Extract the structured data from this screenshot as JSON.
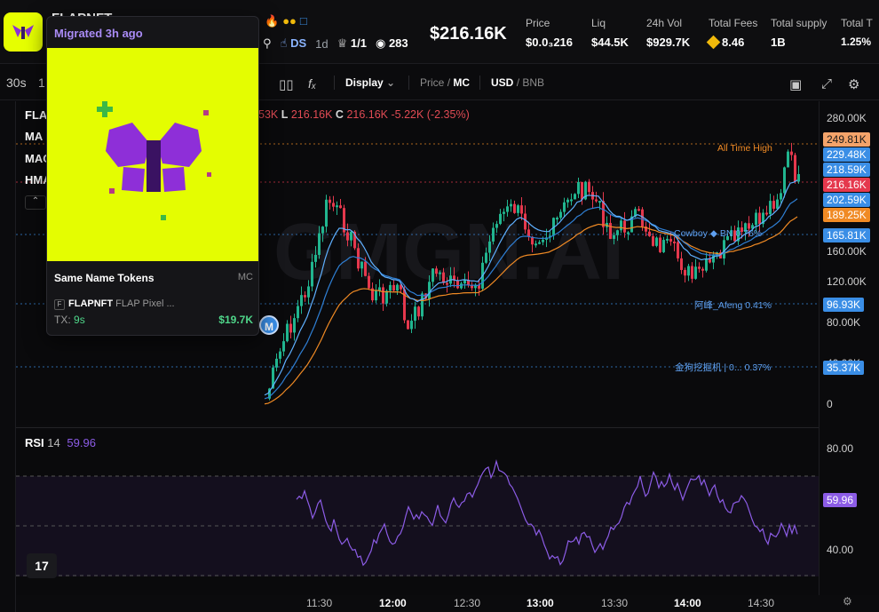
{
  "header": {
    "token_name": "FLAPNFT",
    "market_cap": "$216.16K",
    "meta": {
      "ds_label": "DS",
      "age": "1d",
      "holders_ratio": "1/1",
      "views": "283"
    },
    "stats": [
      {
        "label": "Price",
        "value": "$0.0₃216"
      },
      {
        "label": "Liq",
        "value": "$44.5K"
      },
      {
        "label": "24h Vol",
        "value": "$929.7K"
      },
      {
        "label": "Total Fees",
        "value": "8.46"
      },
      {
        "label": "Total supply",
        "value": "1B"
      },
      {
        "label": "Total T",
        "value": "1.25%"
      }
    ]
  },
  "toolbar": {
    "interval_30s": "30s",
    "interval_1": "1",
    "display_label": "Display",
    "price_label": "Price",
    "mc_label": "MC",
    "usd_label": "USD",
    "bnb_label": "BNB",
    "slash": "/"
  },
  "legend": {
    "title": "FLA",
    "ma": "MA",
    "mac": "MAC",
    "hma": "HMA",
    "ohlc_prefix": "53K",
    "low_label": "L",
    "low_value": "216.16K",
    "close_label": "C",
    "close_value": "216.16K",
    "change": "-5.22K (-2.35%)"
  },
  "price_axis": {
    "ticks": [
      "280.00K",
      "160.00K",
      "120.00K",
      "80.00K",
      "40.00K",
      "0"
    ],
    "tags": [
      {
        "text": "249.81K",
        "color": "#f4a36a"
      },
      {
        "text": "229.48K",
        "color": "#3a8ee6"
      },
      {
        "text": "218.59K",
        "color": "#3a8ee6"
      },
      {
        "text": "216.16K",
        "color": "#e5384d"
      },
      {
        "text": "202.59K",
        "color": "#3a8ee6"
      },
      {
        "text": "189.25K",
        "color": "#f08a24"
      },
      {
        "text": "165.81K",
        "color": "#3a8ee6"
      },
      {
        "text": "96.93K",
        "color": "#3a8ee6"
      },
      {
        "text": "35.37K",
        "color": "#3a8ee6"
      }
    ],
    "rsi_ticks": [
      "80.00",
      "40.00"
    ],
    "rsi_tag": "59.96"
  },
  "annotations": {
    "ath": "All Time High",
    "cowboy": "Cowboy ◆ BN  0.76%",
    "afeng": "阿峰_Afeng 0.41%",
    "miner": "金狗挖掘机 | 0...  0.37%",
    "marker": "M"
  },
  "rsi": {
    "label": "RSI",
    "period": "14",
    "value": "59.96"
  },
  "time_axis": [
    "11:30",
    "12:00",
    "12:30",
    "13:00",
    "13:30",
    "14:00",
    "14:30"
  ],
  "popup": {
    "title": "Migrated 3h ago",
    "section": "Same Name Tokens",
    "section_right": "MC",
    "row_symbol": "FLAPNFT",
    "row_name": "FLAP Pixel ...",
    "tx_label": "TX:",
    "tx_value": "9s",
    "amount": "$19.7K"
  },
  "brand": {
    "watermark": "GMGN.AI"
  },
  "colors": {
    "up": "#21b58f",
    "down": "#e5384d",
    "accent": "#a98bf5",
    "rsi": "#8c5ce6",
    "ma_blue": "#2f7fd4",
    "ma_orange": "#f08a24"
  }
}
